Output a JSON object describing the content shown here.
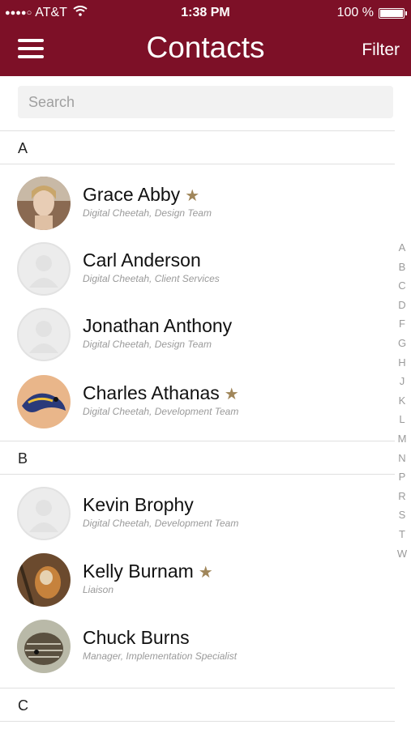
{
  "status": {
    "carrier": "AT&T",
    "time": "1:38 PM",
    "battery": "100 %"
  },
  "header": {
    "title": "Contacts",
    "filter_label": "Filter"
  },
  "search": {
    "placeholder": "Search"
  },
  "sections": [
    {
      "letter": "A"
    },
    {
      "letter": "B"
    },
    {
      "letter": "C"
    }
  ],
  "contacts": [
    {
      "name": "Grace Abby",
      "subtitle": "Digital Cheetah, Design Team",
      "favorite": true
    },
    {
      "name": "Carl Anderson",
      "subtitle": "Digital Cheetah, Client Services",
      "favorite": false
    },
    {
      "name": "Jonathan Anthony",
      "subtitle": "Digital Cheetah, Design Team",
      "favorite": false
    },
    {
      "name": "Charles Athanas",
      "subtitle": "Digital Cheetah, Development Team",
      "favorite": true
    },
    {
      "name": "Kevin Brophy",
      "subtitle": "Digital Cheetah, Development Team",
      "favorite": false
    },
    {
      "name": "Kelly Burnam",
      "subtitle": "Liaison",
      "favorite": true
    },
    {
      "name": "Chuck Burns",
      "subtitle": "Manager, Implementation Specialist",
      "favorite": false
    }
  ],
  "index_letters": [
    "A",
    "B",
    "C",
    "D",
    "F",
    "G",
    "H",
    "J",
    "K",
    "L",
    "M",
    "N",
    "P",
    "R",
    "S",
    "T",
    "W"
  ],
  "colors": {
    "header_bg": "#7d1027",
    "star": "#a0865a"
  }
}
